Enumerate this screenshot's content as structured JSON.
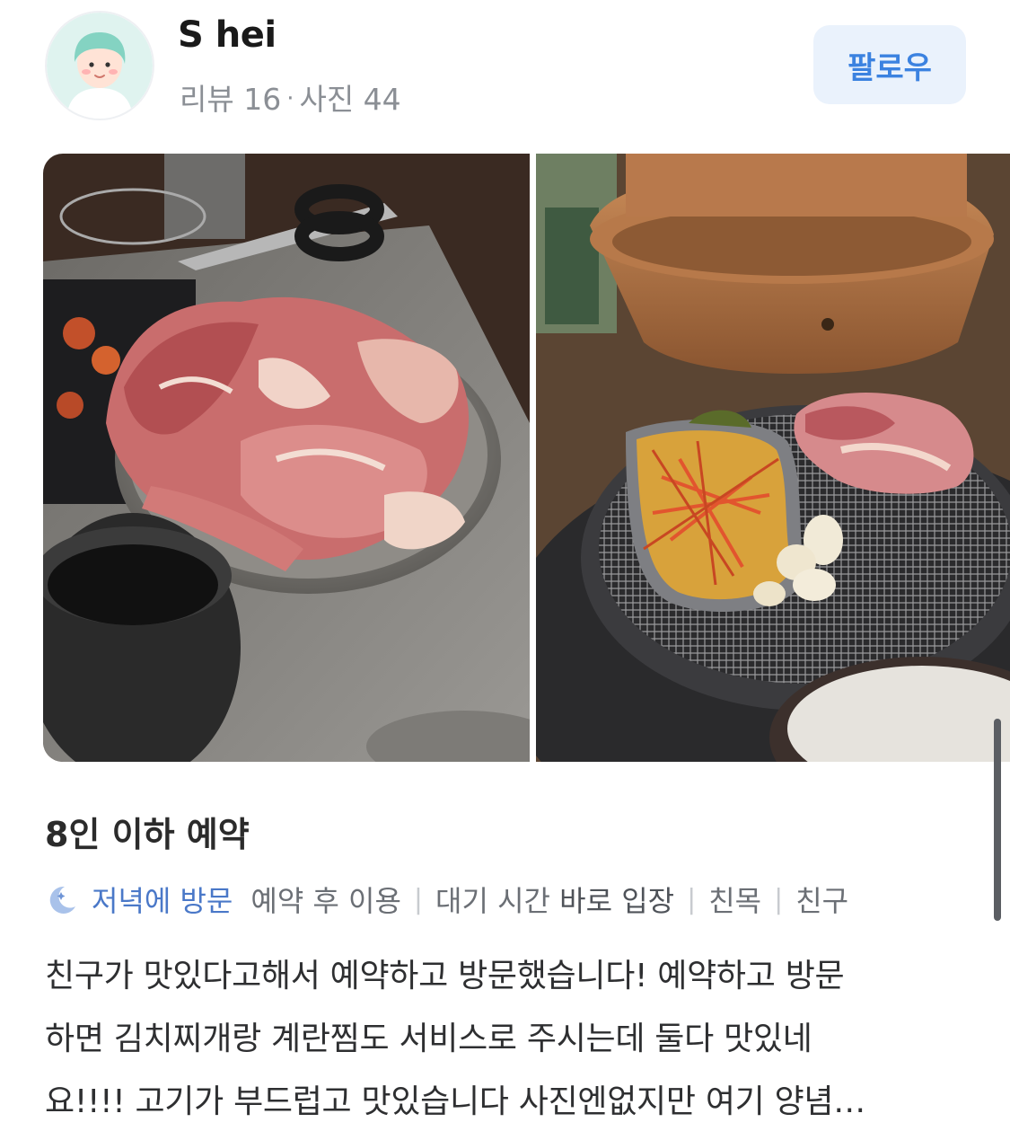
{
  "profile": {
    "name": "S hei",
    "stats": {
      "reviews": "리뷰 16",
      "separator": "·",
      "photos": "사진 44"
    },
    "follow_label": "팔로우"
  },
  "review": {
    "title": "8인 이하 예약",
    "visit_label": "저녁에 방문",
    "tags": [
      "예약 후 이용",
      "대기 시간",
      "바로 입장",
      "친목",
      "친구"
    ],
    "separator": "|",
    "body_lines": [
      "친구가 맛있다고해서 예약하고 방문했습니다! 예약하고 방문",
      "하면 김치찌개랑 계란찜도 서비스로 주시는데 둘다 맛있네",
      "요!!!! 고기가 부드럽고 맛있습니다 사진엔없지만 여기 양념…"
    ]
  },
  "colors": {
    "accent": "#3b82e0",
    "visit": "#4a78c8",
    "follow_bg": "#eaf2fc"
  },
  "icons": {
    "moon": "crescent-moon-icon"
  }
}
